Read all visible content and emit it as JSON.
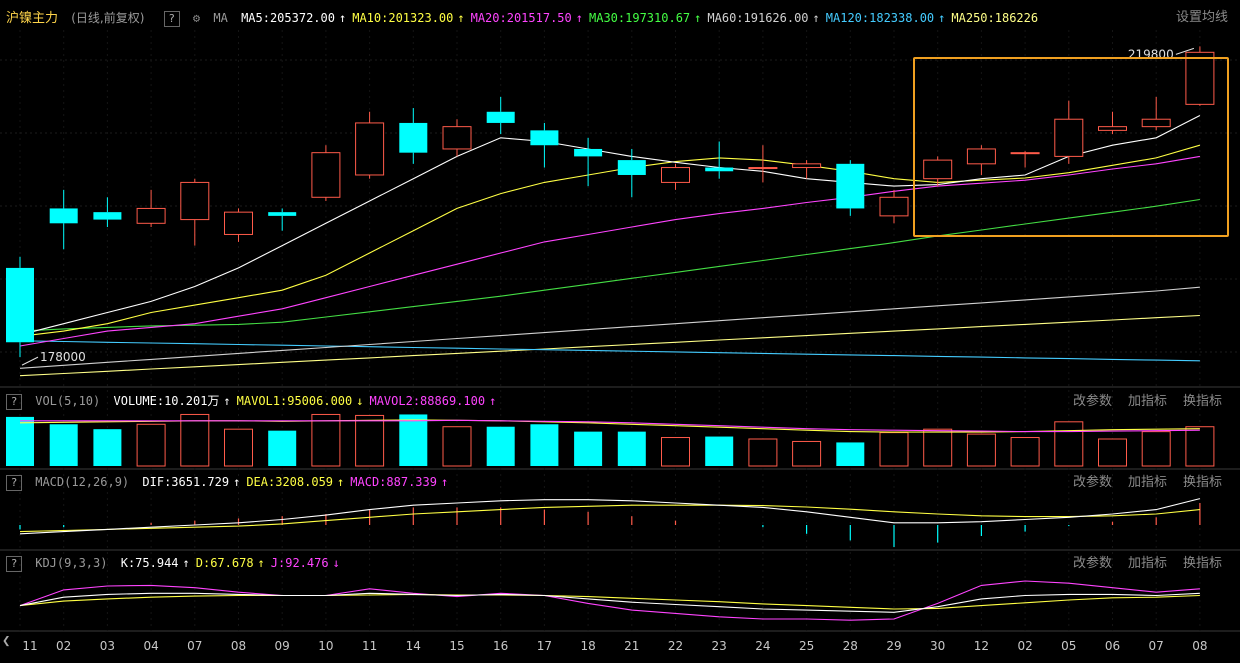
{
  "header": {
    "title": "沪镍主力",
    "period": "(日线,前复权)",
    "question_mark": "?",
    "indicator": "MA",
    "ma_items": [
      {
        "label": "MA5:205372.00",
        "arrow": "↑",
        "color": "#ffffff"
      },
      {
        "label": "MA10:201323.00",
        "arrow": "↑",
        "color": "#ffff44"
      },
      {
        "label": "MA20:201517.50",
        "arrow": "↑",
        "color": "#ff44ff"
      },
      {
        "label": "MA30:197310.67",
        "arrow": "↑",
        "color": "#44ff44"
      },
      {
        "label": "MA60:191626.00",
        "arrow": "↑",
        "color": "#d0d0d0"
      },
      {
        "label": "MA120:182338.00",
        "arrow": "↑",
        "color": "#44ccff"
      },
      {
        "label": "MA250:186226",
        "arrow": "",
        "color": "#ffff88"
      }
    ],
    "settings_link": "设置均线"
  },
  "vol_panel": {
    "name": "VOL(5,10)",
    "items": [
      {
        "label": "VOLUME:10.201万",
        "arrow": "↑",
        "color": "#ffffff"
      },
      {
        "label": "MAVOL1:95006.000",
        "arrow": "↓",
        "color": "#ffff44"
      },
      {
        "label": "MAVOL2:88869.100",
        "arrow": "↑",
        "color": "#ff44ff"
      }
    ],
    "links": [
      "改参数",
      "加指标",
      "换指标"
    ]
  },
  "macd_panel": {
    "name": "MACD(12,26,9)",
    "items": [
      {
        "label": "DIF:3651.729",
        "arrow": "↑",
        "color": "#ffffff"
      },
      {
        "label": "DEA:3208.059",
        "arrow": "↑",
        "color": "#ffff44"
      },
      {
        "label": "MACD:887.339",
        "arrow": "↑",
        "color": "#ff44ff"
      }
    ],
    "links": [
      "改参数",
      "加指标",
      "换指标"
    ]
  },
  "kdj_panel": {
    "name": "KDJ(9,3,3)",
    "items": [
      {
        "label": "K:75.944",
        "arrow": "↑",
        "color": "#ffffff"
      },
      {
        "label": "D:67.678",
        "arrow": "↑",
        "color": "#ffff44"
      },
      {
        "label": "J:92.476",
        "arrow": "↓",
        "color": "#ff44ff"
      }
    ],
    "links": [
      "改参数",
      "加指标",
      "换指标"
    ]
  },
  "chart_data": {
    "type": "candlestick",
    "low_label": "178000",
    "high_label": "219800",
    "price_range": [
      176000,
      222000
    ],
    "x_labels": [
      "11",
      "02",
      "03",
      "04",
      "07",
      "08",
      "09",
      "10",
      "11",
      "14",
      "15",
      "16",
      "17",
      "18",
      "21",
      "22",
      "23",
      "24",
      "25",
      "28",
      "29",
      "30",
      "12",
      "02",
      "05",
      "06",
      "07",
      "08"
    ],
    "candles": [
      {
        "o": 190000,
        "h": 191500,
        "l": 178000,
        "c": 180000
      },
      {
        "o": 198000,
        "h": 200500,
        "l": 192500,
        "c": 196000
      },
      {
        "o": 197500,
        "h": 199500,
        "l": 195500,
        "c": 196500
      },
      {
        "o": 196000,
        "h": 200500,
        "l": 195500,
        "c": 198000
      },
      {
        "o": 196500,
        "h": 202000,
        "l": 193000,
        "c": 201500
      },
      {
        "o": 194500,
        "h": 198000,
        "l": 193500,
        "c": 197500
      },
      {
        "o": 197500,
        "h": 198000,
        "l": 195000,
        "c": 197000
      },
      {
        "o": 199500,
        "h": 206500,
        "l": 199000,
        "c": 205500
      },
      {
        "o": 202500,
        "h": 211000,
        "l": 202000,
        "c": 209500
      },
      {
        "o": 209500,
        "h": 211500,
        "l": 204000,
        "c": 205500
      },
      {
        "o": 206000,
        "h": 210000,
        "l": 205000,
        "c": 209000
      },
      {
        "o": 211000,
        "h": 213000,
        "l": 208000,
        "c": 209500
      },
      {
        "o": 208500,
        "h": 209500,
        "l": 203500,
        "c": 206500
      },
      {
        "o": 206000,
        "h": 207500,
        "l": 201000,
        "c": 205000
      },
      {
        "o": 204500,
        "h": 206000,
        "l": 199500,
        "c": 202500
      },
      {
        "o": 201500,
        "h": 204000,
        "l": 200500,
        "c": 203500
      },
      {
        "o": 203500,
        "h": 207000,
        "l": 202000,
        "c": 203000
      },
      {
        "o": 203500,
        "h": 206500,
        "l": 201500,
        "c": 203500
      },
      {
        "o": 203500,
        "h": 204500,
        "l": 202000,
        "c": 204000
      },
      {
        "o": 204000,
        "h": 204500,
        "l": 197000,
        "c": 198000
      },
      {
        "o": 197000,
        "h": 200500,
        "l": 196000,
        "c": 199500
      },
      {
        "o": 202000,
        "h": 205000,
        "l": 201000,
        "c": 204500
      },
      {
        "o": 204000,
        "h": 206500,
        "l": 202500,
        "c": 206000
      },
      {
        "o": 205500,
        "h": 205700,
        "l": 203500,
        "c": 205500
      },
      {
        "o": 205000,
        "h": 212500,
        "l": 204000,
        "c": 210000
      },
      {
        "o": 208500,
        "h": 211000,
        "l": 208000,
        "c": 209000
      },
      {
        "o": 209000,
        "h": 213000,
        "l": 208500,
        "c": 210000
      },
      {
        "o": 212000,
        "h": 219800,
        "l": 211800,
        "c": 219000
      }
    ],
    "ma5": [
      181000,
      182500,
      184000,
      185500,
      187500,
      190000,
      193000,
      196000,
      199000,
      202000,
      205000,
      207500,
      207000,
      206000,
      205000,
      204200,
      203500,
      203000,
      202000,
      201500,
      201000,
      201200,
      202000,
      202500,
      205000,
      206500,
      207500,
      210500
    ],
    "ma10": [
      180800,
      181500,
      182500,
      184000,
      185000,
      186000,
      187000,
      189000,
      192000,
      195000,
      198000,
      200000,
      201500,
      202500,
      203500,
      204300,
      204800,
      204500,
      203800,
      203000,
      202000,
      201500,
      201800,
      202100,
      202800,
      203800,
      204800,
      206500
    ],
    "ma20": [
      179500,
      180500,
      181500,
      182000,
      182500,
      183500,
      184500,
      186000,
      187500,
      189000,
      190500,
      192000,
      193500,
      194500,
      195500,
      196500,
      197300,
      198000,
      198800,
      199500,
      200300,
      201000,
      201400,
      201800,
      202500,
      203300,
      204000,
      205000
    ],
    "ma30": [
      181500,
      181800,
      182000,
      182200,
      182300,
      182400,
      182700,
      183400,
      184100,
      184800,
      185500,
      186200,
      187000,
      187800,
      188600,
      189400,
      190200,
      191000,
      191800,
      192600,
      193400,
      194300,
      195100,
      195900,
      196700,
      197500,
      198300,
      199200
    ],
    "ma60": [
      176500,
      176900,
      177300,
      177700,
      178100,
      178500,
      178900,
      179300,
      179700,
      180100,
      180500,
      180900,
      181300,
      181700,
      182100,
      182500,
      182900,
      183300,
      183700,
      184100,
      184500,
      184900,
      185300,
      185700,
      186100,
      186500,
      186900,
      187400
    ],
    "ma120": [
      180200,
      180100,
      180000,
      179900,
      179800,
      179700,
      179600,
      179500,
      179400,
      179300,
      179200,
      179100,
      179000,
      178900,
      178800,
      178700,
      178600,
      178500,
      178400,
      178300,
      178200,
      178100,
      178000,
      177900,
      177800,
      177700,
      177600,
      177500
    ],
    "ma250": [
      175500,
      175800,
      176100,
      176400,
      176700,
      177000,
      177300,
      177600,
      177900,
      178200,
      178500,
      178800,
      179100,
      179400,
      179700,
      180000,
      180300,
      180600,
      180900,
      181200,
      181500,
      181800,
      182100,
      182400,
      182700,
      183000,
      183300,
      183600
    ],
    "volume": [
      10.0,
      8.5,
      7.5,
      8.5,
      10.5,
      7.5,
      7.2,
      10.5,
      10.3,
      10.5,
      8.0,
      8.0,
      8.5,
      7.0,
      7.0,
      5.8,
      6.0,
      5.5,
      5.0,
      4.8,
      6.8,
      7.5,
      6.5,
      5.8,
      9.0,
      5.5,
      7.0,
      8.0
    ],
    "mavol1": [
      8.8,
      8.9,
      9.0,
      9.1,
      9.2,
      9.2,
      9.1,
      9.2,
      9.3,
      9.4,
      9.3,
      9.2,
      9.0,
      8.8,
      8.5,
      8.2,
      7.9,
      7.6,
      7.3,
      7.0,
      6.9,
      6.9,
      6.9,
      7.0,
      7.2,
      7.4,
      7.5,
      7.6
    ],
    "mavol2": [
      9.2,
      9.2,
      9.2,
      9.2,
      9.2,
      9.2,
      9.2,
      9.2,
      9.2,
      9.2,
      9.3,
      9.2,
      9.1,
      9.0,
      8.8,
      8.5,
      8.2,
      7.9,
      7.6,
      7.4,
      7.3,
      7.2,
      7.1,
      7.0,
      7.0,
      7.1,
      7.2,
      7.3
    ],
    "dif": [
      -0.4,
      -0.3,
      -0.2,
      -0.1,
      0.0,
      0.1,
      0.25,
      0.45,
      0.7,
      0.9,
      1.0,
      1.1,
      1.15,
      1.15,
      1.1,
      1.0,
      0.9,
      0.8,
      0.6,
      0.35,
      0.1,
      0.1,
      0.15,
      0.25,
      0.35,
      0.5,
      0.7,
      1.2
    ],
    "dea": [
      -0.3,
      -0.25,
      -0.2,
      -0.15,
      -0.1,
      -0.05,
      0.05,
      0.2,
      0.35,
      0.5,
      0.6,
      0.7,
      0.8,
      0.85,
      0.9,
      0.9,
      0.9,
      0.88,
      0.82,
      0.72,
      0.6,
      0.5,
      0.42,
      0.38,
      0.38,
      0.42,
      0.5,
      0.7
    ],
    "macd_hist": [
      -0.2,
      -0.1,
      0.0,
      0.1,
      0.2,
      0.3,
      0.4,
      0.5,
      0.7,
      0.8,
      0.8,
      0.8,
      0.7,
      0.6,
      0.4,
      0.2,
      0.0,
      -0.1,
      -0.4,
      -0.7,
      -1.0,
      -0.8,
      -0.5,
      -0.3,
      -0.05,
      0.15,
      0.35,
      1.0
    ],
    "k": [
      40,
      55,
      60,
      62,
      62,
      60,
      58,
      58,
      62,
      60,
      58,
      60,
      58,
      52,
      46,
      42,
      38,
      34,
      32,
      30,
      28,
      38,
      52,
      58,
      60,
      60,
      58,
      62
    ],
    "d": [
      40,
      48,
      52,
      55,
      57,
      58,
      58,
      58,
      59,
      60,
      59,
      59,
      58,
      56,
      53,
      50,
      47,
      43,
      40,
      37,
      34,
      35,
      40,
      45,
      50,
      54,
      55,
      58
    ],
    "j": [
      40,
      68,
      75,
      76,
      72,
      64,
      58,
      58,
      70,
      62,
      56,
      62,
      58,
      44,
      32,
      26,
      20,
      16,
      16,
      14,
      16,
      44,
      76,
      84,
      80,
      72,
      64,
      70
    ],
    "highlight_box": "orange"
  }
}
